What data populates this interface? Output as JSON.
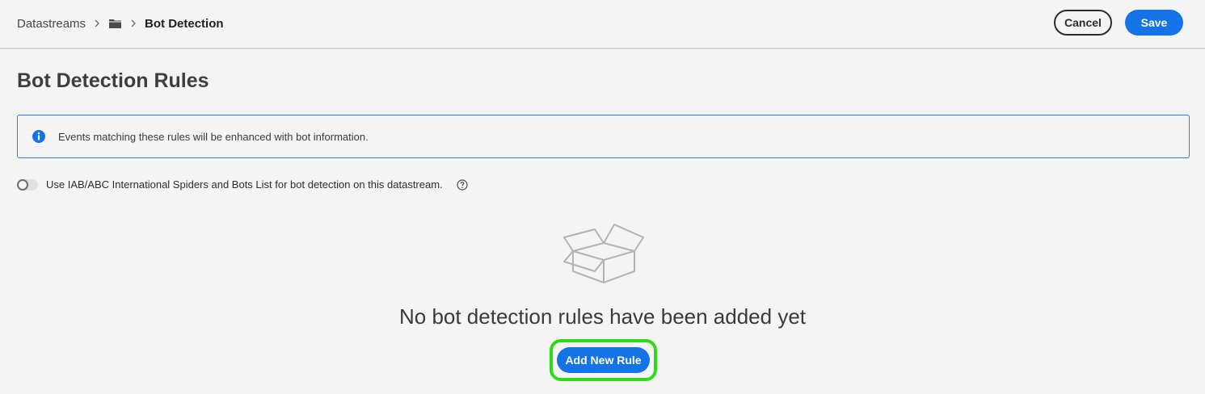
{
  "breadcrumb": {
    "root": "Datastreams",
    "folder_icon": "folder-icon",
    "current": "Bot Detection"
  },
  "header": {
    "cancel_label": "Cancel",
    "save_label": "Save"
  },
  "page": {
    "title": "Bot Detection Rules"
  },
  "info_banner": {
    "icon": "info-icon",
    "text": "Events matching these rules will be enhanced with bot information."
  },
  "toggle": {
    "label": "Use IAB/ABC International Spiders and Bots List for bot detection on this datastream.",
    "checked": false,
    "help_icon": "help-icon"
  },
  "empty_state": {
    "illustration": "empty-box-icon",
    "heading": "No bot detection rules have been added yet",
    "button_label": "Add New Rule"
  },
  "colors": {
    "accent": "#1473e6",
    "banner_border": "#2680eb",
    "highlight": "#2bdc16",
    "background": "#f4f4f4"
  }
}
